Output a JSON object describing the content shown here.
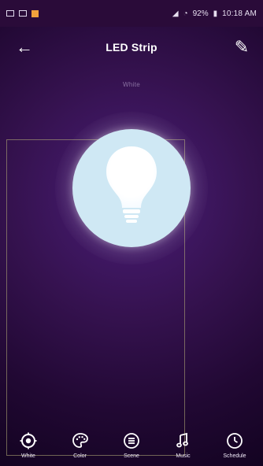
{
  "status_bar": {
    "time": "10:18 AM",
    "battery": "92%"
  },
  "top_bar": {
    "title": "LED Strip"
  },
  "main": {
    "mode_label": "White"
  },
  "bottom_nav": {
    "items": [
      {
        "label": "White",
        "icon": "white-mode-icon"
      },
      {
        "label": "Color",
        "icon": "palette-icon"
      },
      {
        "label": "Scene",
        "icon": "scene-icon"
      },
      {
        "label": "Music",
        "icon": "music-icon"
      },
      {
        "label": "Schedule",
        "icon": "clock-icon"
      }
    ]
  }
}
